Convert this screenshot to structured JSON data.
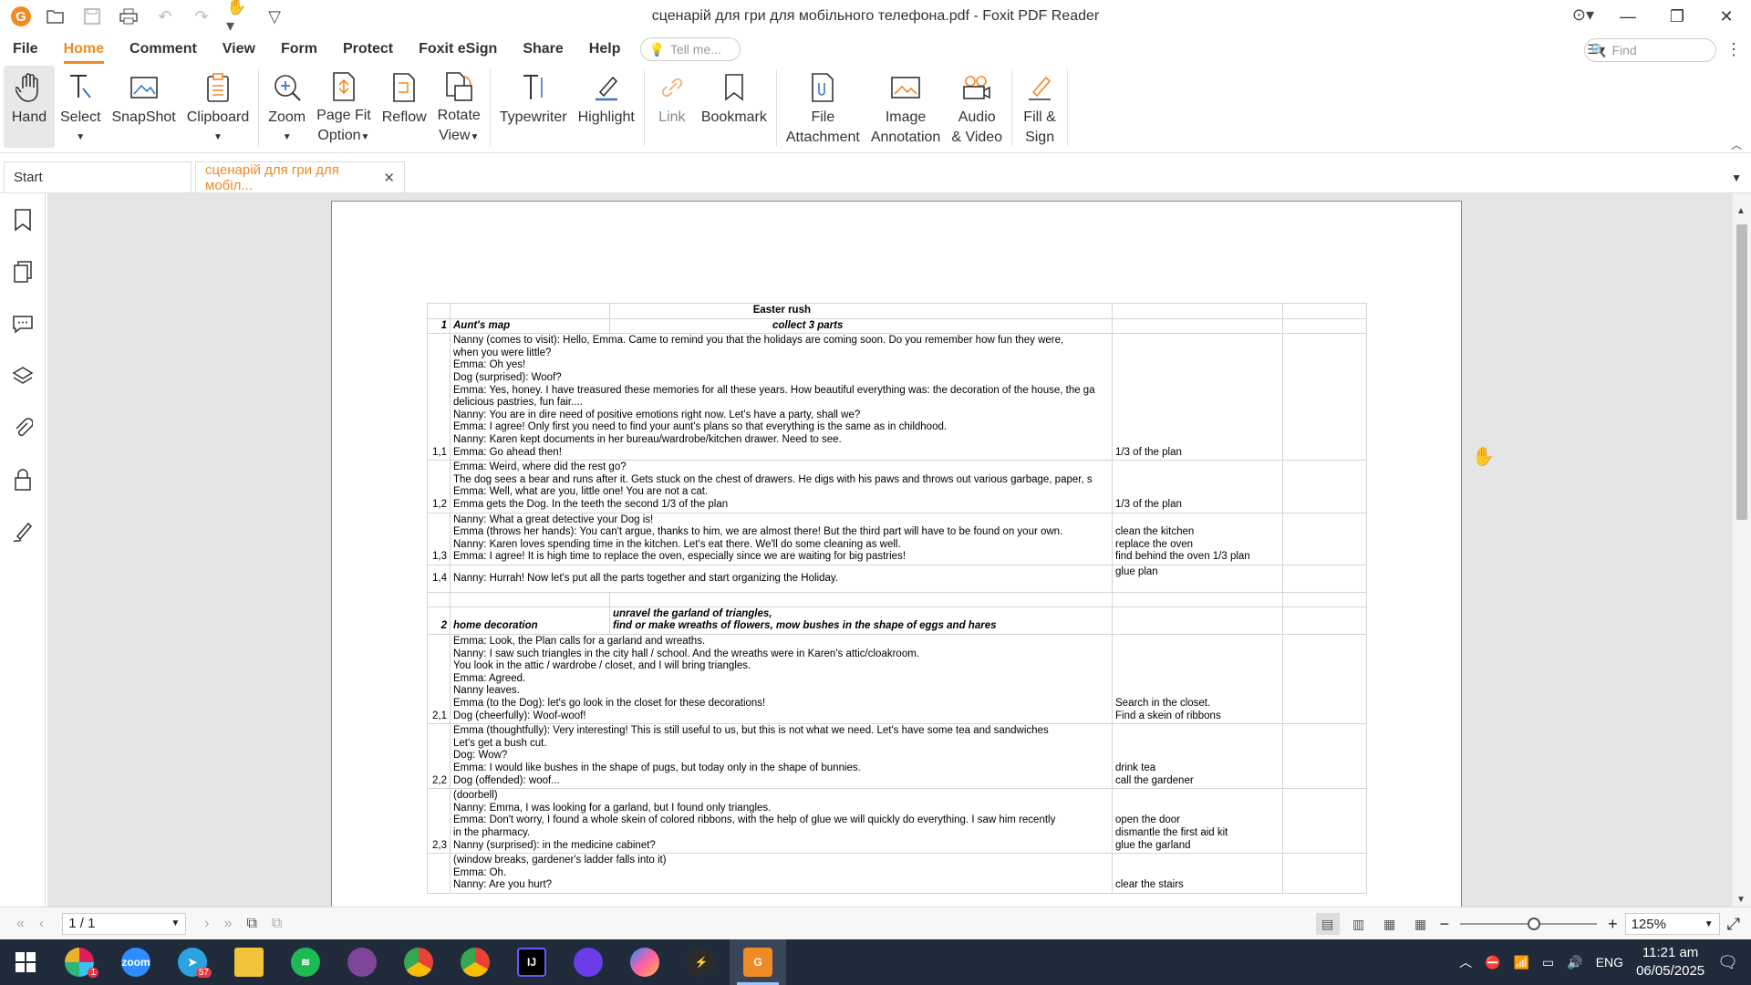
{
  "window": {
    "title": "сценарій для гри для мобільного телефона.pdf - Foxit PDF Reader",
    "logo": "G"
  },
  "menu": {
    "items": [
      "File",
      "Home",
      "Comment",
      "View",
      "Form",
      "Protect",
      "Foxit eSign",
      "Share",
      "Help"
    ],
    "active": "Home",
    "tellme_placeholder": "Tell me...",
    "find_placeholder": "Find"
  },
  "ribbon": {
    "hand": "Hand",
    "select": "Select",
    "snapshot": "SnapShot",
    "clipboard": "Clipboard",
    "zoom": "Zoom",
    "pagefit_1": "Page Fit",
    "pagefit_2": "Option",
    "reflow": "Reflow",
    "rotate_1": "Rotate",
    "rotate_2": "View",
    "typewriter": "Typewriter",
    "highlight": "Highlight",
    "link": "Link",
    "bookmark": "Bookmark",
    "fileatt_1": "File",
    "fileatt_2": "Attachment",
    "imgann_1": "Image",
    "imgann_2": "Annotation",
    "audio_1": "Audio",
    "audio_2": "& Video",
    "fillsign_1": "Fill &",
    "fillsign_2": "Sign"
  },
  "tabs": {
    "start": "Start",
    "doc": "сценарій для гри для мобіл..."
  },
  "document": {
    "title": "Easter rush",
    "s1_num": "1",
    "s1_name": "Aunt's map",
    "s1_task": "collect 3 parts",
    "r11": {
      "num": "1,1",
      "lines": [
        "Nanny (comes to visit): Hello, Emma. Came to remind you that the holidays are coming soon. Do you remember how fun they were,",
        "when you were little?",
        "Emma: Oh yes!",
        "Dog (surprised): Woof?",
        "Emma: Yes, honey. I have treasured these memories for all these years. How beautiful everything was: the decoration of the house, the ga",
        "delicious pastries, fun fair....",
        "Nanny: You are in dire need of positive emotions right now. Let's have a party, shall we?",
        "Emma: I agree! Only first you need to find your aunt's plans so that everything is the same as in childhood.",
        "Nanny: Karen kept documents in her bureau/wardrobe/kitchen drawer. Need to see.",
        "Emma: Go ahead then!"
      ],
      "action": [
        "1/3 of the plan"
      ]
    },
    "r12": {
      "num": "1,2",
      "lines": [
        "Emma: Weird, where did the rest go?",
        "The dog sees a bear and runs after it. Gets stuck on the chest of drawers. He digs with his paws and throws out various garbage, paper, s",
        "Emma: Well, what are you, little one! You are not a cat.",
        "Emma gets the Dog. In the teeth the second 1/3 of the plan"
      ],
      "action": [
        "1/3 of the plan"
      ]
    },
    "r13": {
      "num": "1,3",
      "lines": [
        "Nanny: What a great detective your Dog is!",
        "Emma (throws her hands): You can't argue, thanks to him, we are almost there! But the third part will have to be found on your own.",
        "Nanny: Karen loves spending time in the kitchen. Let's eat there. We'll do some cleaning as well.",
        "Emma: I agree! It is high time to replace the oven, especially since we are waiting for big pastries!"
      ],
      "action": [
        "clean the kitchen",
        "replace the oven",
        "find behind the oven 1/3 plan"
      ]
    },
    "r14": {
      "num": "1,4",
      "lines": [
        "Nanny: Hurrah! Now let's put all the parts together and start organizing the Holiday."
      ],
      "action": [
        "glue plan"
      ]
    },
    "s2_num": "2",
    "s2_name": "home decoration",
    "s2_task_1": "unravel the garland of triangles,",
    "s2_task_2": "find or make wreaths of flowers, mow bushes in the shape of eggs and hares",
    "r21": {
      "num": "2,1",
      "lines": [
        "Emma: Look, the Plan calls for a garland and wreaths.",
        "Nanny: I saw such triangles in the city hall / school. And the wreaths were in Karen's attic/cloakroom.",
        "You look in the attic / wardrobe / closet, and I will bring triangles.",
        "Emma: Agreed.",
        "Nanny leaves.",
        "Emma (to the Dog): let's go look in the closet for these decorations!",
        "Dog (cheerfully): Woof-woof!"
      ],
      "action": [
        "Search in the closet.",
        "Find a skein of ribbons"
      ]
    },
    "r22": {
      "num": "2,2",
      "lines": [
        "Emma (thoughtfully): Very interesting! This is still useful to us, but this is not what we need. Let's have some tea and sandwiches",
        "Let's get a bush cut.",
        "Dog: Wow?",
        "Emma: I would like bushes in the shape of pugs, but today only in the shape of bunnies.",
        "Dog (offended): woof..."
      ],
      "action": [
        "drink tea",
        "call the gardener"
      ]
    },
    "r23": {
      "num": "2,3",
      "lines": [
        "(doorbell)",
        "Nanny: Emma, I was looking for a garland, but I found only triangles.",
        "Emma: Don't worry, I found a whole skein of colored ribbons, with the help of glue we will quickly do everything. I saw him recently",
        "in the pharmacy.",
        "Nanny (surprised): in the medicine cabinet?"
      ],
      "action": [
        "open the door",
        "dismantle the first aid kit",
        "glue the garland"
      ]
    },
    "r24": {
      "lines": [
        "(window breaks, gardener's ladder falls into it)",
        "Emma: Oh.",
        "Nanny: Are you hurt?"
      ],
      "action": [
        "clear the stairs"
      ]
    }
  },
  "status": {
    "page": "1 / 1",
    "zoom": "125%"
  },
  "taskbar": {
    "telegram_badge": "57",
    "slack_badge": "1",
    "lang": "ENG",
    "time": "11:21 am",
    "date": "06/05/2025"
  },
  "colors": {
    "accent": "#f08a24",
    "taskbar": "#1f2a3a"
  }
}
